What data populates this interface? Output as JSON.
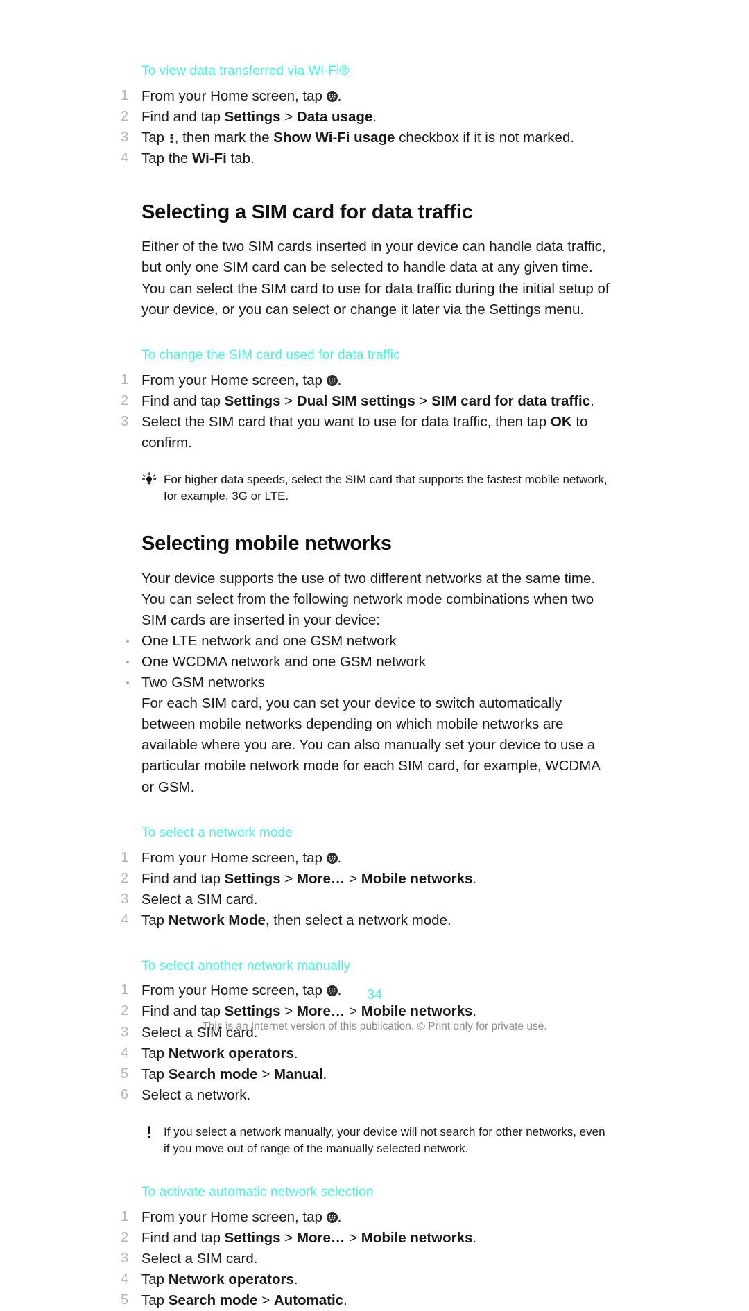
{
  "document": {
    "page_number": "34",
    "footer_note": "This is an Internet version of this publication. © Print only for private use.",
    "accent_color": "#45f5dd",
    "step_number_color": "#b4b4b4"
  },
  "sections": [
    {
      "id": "view-data-wifi",
      "type": "procedure",
      "heading": "To view data transferred via Wi-Fi®",
      "steps": [
        {
          "parts": [
            {
              "t": "From your Home screen, tap "
            },
            {
              "icon": "app-drawer-icon"
            },
            {
              "t": "."
            }
          ]
        },
        {
          "parts": [
            {
              "t": "Find and tap "
            },
            {
              "b": "Settings"
            },
            {
              "t": " > "
            },
            {
              "b": "Data usage"
            },
            {
              "t": "."
            }
          ]
        },
        {
          "parts": [
            {
              "t": "Tap "
            },
            {
              "icon": "overflow-menu-icon"
            },
            {
              "t": ", then mark the "
            },
            {
              "b": "Show Wi-Fi usage"
            },
            {
              "t": " checkbox if it is not marked."
            }
          ]
        },
        {
          "parts": [
            {
              "t": "Tap the "
            },
            {
              "b": "Wi-Fi"
            },
            {
              "t": " tab."
            }
          ]
        }
      ]
    },
    {
      "id": "selecting-sim-card",
      "type": "section",
      "heading": "Selecting a SIM card for data traffic",
      "paragraph": "Either of the two SIM cards inserted in your device can handle data traffic, but only one SIM card can be selected to handle data at any given time. You can select the SIM card to use for data traffic during the initial setup of your device, or you can select or change it later via the Settings menu."
    },
    {
      "id": "change-sim-card",
      "type": "procedure",
      "heading": "To change the SIM card used for data traffic",
      "steps": [
        {
          "parts": [
            {
              "t": "From your Home screen, tap "
            },
            {
              "icon": "app-drawer-icon"
            },
            {
              "t": "."
            }
          ]
        },
        {
          "parts": [
            {
              "t": "Find and tap "
            },
            {
              "b": "Settings"
            },
            {
              "t": " > "
            },
            {
              "b": "Dual SIM settings"
            },
            {
              "t": " > "
            },
            {
              "b": "SIM card for data traffic"
            },
            {
              "t": "."
            }
          ]
        },
        {
          "parts": [
            {
              "t": "Select the SIM card that you want to use for data traffic, then tap "
            },
            {
              "b": "OK"
            },
            {
              "t": " to confirm."
            }
          ]
        }
      ],
      "note": {
        "icon": "lightbulb-tip-icon",
        "text": "For higher data speeds, select the SIM card that supports the fastest mobile network, for example, 3G or LTE."
      }
    },
    {
      "id": "selecting-mobile-networks",
      "type": "section",
      "heading": "Selecting mobile networks",
      "paragraph": "Your device supports the use of two different networks at the same time. You can select from the following network mode combinations when two SIM cards are inserted in your device:",
      "bullets": [
        "One LTE network and one GSM network",
        "One WCDMA network and one GSM network",
        "Two GSM networks"
      ],
      "paragraph2": "For each SIM card, you can set your device to switch automatically between mobile networks depending on which mobile networks are available where you are. You can also manually set your device to use a particular mobile network mode for each SIM card, for example, WCDMA or GSM."
    },
    {
      "id": "select-network-mode",
      "type": "procedure",
      "heading": "To select a network mode",
      "steps": [
        {
          "parts": [
            {
              "t": "From your Home screen, tap "
            },
            {
              "icon": "app-drawer-icon"
            },
            {
              "t": "."
            }
          ]
        },
        {
          "parts": [
            {
              "t": "Find and tap "
            },
            {
              "b": "Settings"
            },
            {
              "t": " > "
            },
            {
              "b": "More…"
            },
            {
              "t": " > "
            },
            {
              "b": "Mobile networks"
            },
            {
              "t": "."
            }
          ]
        },
        {
          "parts": [
            {
              "t": "Select a SIM card."
            }
          ]
        },
        {
          "parts": [
            {
              "t": "Tap "
            },
            {
              "b": "Network Mode"
            },
            {
              "t": ", then select a network mode."
            }
          ]
        }
      ]
    },
    {
      "id": "select-network-manually",
      "type": "procedure",
      "heading": "To select another network manually",
      "steps": [
        {
          "parts": [
            {
              "t": "From your Home screen, tap "
            },
            {
              "icon": "app-drawer-icon"
            },
            {
              "t": "."
            }
          ]
        },
        {
          "parts": [
            {
              "t": "Find and tap "
            },
            {
              "b": "Settings"
            },
            {
              "t": " > "
            },
            {
              "b": "More…"
            },
            {
              "t": " > "
            },
            {
              "b": "Mobile networks"
            },
            {
              "t": "."
            }
          ]
        },
        {
          "parts": [
            {
              "t": "Select a SIM card."
            }
          ]
        },
        {
          "parts": [
            {
              "t": "Tap "
            },
            {
              "b": "Network operators"
            },
            {
              "t": "."
            }
          ]
        },
        {
          "parts": [
            {
              "t": "Tap "
            },
            {
              "b": "Search mode"
            },
            {
              "t": " > "
            },
            {
              "b": "Manual"
            },
            {
              "t": "."
            }
          ]
        },
        {
          "parts": [
            {
              "t": "Select a network."
            }
          ]
        }
      ],
      "note": {
        "icon": "warning-exclamation-icon",
        "text": "If you select a network manually, your device will not search for other networks, even if you move out of range of the manually selected network."
      }
    },
    {
      "id": "activate-automatic-selection",
      "type": "procedure",
      "heading": "To activate automatic network selection",
      "steps": [
        {
          "parts": [
            {
              "t": "From your Home screen, tap "
            },
            {
              "icon": "app-drawer-icon"
            },
            {
              "t": "."
            }
          ]
        },
        {
          "parts": [
            {
              "t": "Find and tap "
            },
            {
              "b": "Settings"
            },
            {
              "t": " > "
            },
            {
              "b": "More…"
            },
            {
              "t": " > "
            },
            {
              "b": "Mobile networks"
            },
            {
              "t": "."
            }
          ]
        },
        {
          "parts": [
            {
              "t": "Select a SIM card."
            }
          ]
        },
        {
          "parts": [
            {
              "t": "Tap "
            },
            {
              "b": "Network operators"
            },
            {
              "t": "."
            }
          ]
        },
        {
          "parts": [
            {
              "t": "Tap "
            },
            {
              "b": "Search mode"
            },
            {
              "t": " > "
            },
            {
              "b": "Automatic"
            },
            {
              "t": "."
            }
          ]
        }
      ]
    }
  ]
}
